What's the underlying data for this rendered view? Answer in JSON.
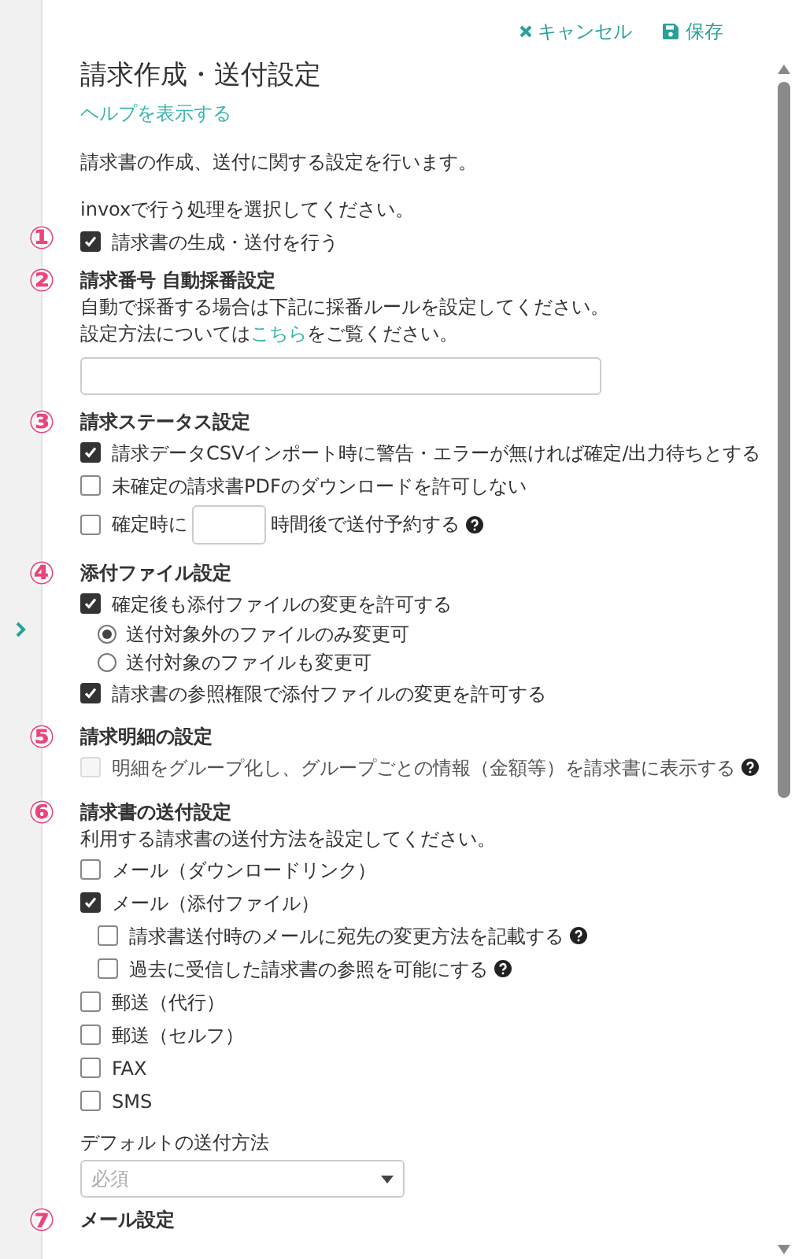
{
  "toolbar": {
    "cancel": "キャンセル",
    "save": "保存"
  },
  "title": "請求作成・送付設定",
  "help_link": "ヘルプを表示する",
  "description": "請求書の作成、送付に関する設定を行います。",
  "prompt": "invoxで行う処理を選択してください。",
  "sections": [
    {
      "marker": "①",
      "items": [
        {
          "kind": "checkbox",
          "label": "請求書の生成・送付を行う",
          "checked": true
        }
      ]
    },
    {
      "marker": "②",
      "heading": "請求番号 自動採番設定",
      "items": [
        {
          "kind": "text",
          "text": "自動で採番する場合は下記に採番ルールを設定してください。"
        },
        {
          "kind": "link_text",
          "before": "設定方法については",
          "link": "こちら",
          "after": "をご覧ください。"
        },
        {
          "kind": "field"
        }
      ]
    },
    {
      "marker": "③",
      "heading": "請求ステータス設定",
      "items": [
        {
          "kind": "checkbox",
          "label": "請求データCSVインポート時に警告・エラーが無ければ確定/出力待ちとする",
          "checked": true
        },
        {
          "kind": "checkbox",
          "label": "未確定の請求書PDFのダウンロードを許可しない",
          "checked": false
        },
        {
          "kind": "hours",
          "before": "確定時に",
          "after": "時間後で送付予約する",
          "checked": false,
          "help": true
        }
      ]
    },
    {
      "marker": "④",
      "heading": "添付ファイル設定",
      "items": [
        {
          "kind": "checkbox",
          "label": "確定後も添付ファイルの変更を許可する",
          "checked": true,
          "children": [
            {
              "kind": "radio",
              "label": "送付対象外のファイルのみ変更可",
              "selected": true
            },
            {
              "kind": "radio",
              "label": "送付対象のファイルも変更可",
              "selected": false
            }
          ]
        },
        {
          "kind": "checkbox",
          "label": "請求書の参照権限で添付ファイルの変更を許可する",
          "checked": true
        }
      ]
    },
    {
      "marker": "⑤",
      "heading": "請求明細の設定",
      "items": [
        {
          "kind": "checkbox",
          "label": "明細をグループ化し、グループごとの情報（金額等）を請求書に表示する",
          "checked": false,
          "disabled": true,
          "help": true
        }
      ]
    },
    {
      "marker": "⑥",
      "heading": "請求書の送付設定",
      "items": [
        {
          "kind": "text",
          "text": "利用する請求書の送付方法を設定してください。"
        },
        {
          "kind": "checkbox",
          "label": "メール（ダウンロードリンク）",
          "checked": false
        },
        {
          "kind": "checkbox",
          "label": "メール（添付ファイル）",
          "checked": true,
          "children": [
            {
              "kind": "checkbox",
              "label": "請求書送付時のメールに宛先の変更方法を記載する",
              "checked": false,
              "help": true
            },
            {
              "kind": "checkbox",
              "label": "過去に受信した請求書の参照を可能にする",
              "checked": false,
              "help": true
            }
          ]
        },
        {
          "kind": "checkbox",
          "label": "郵送（代行）",
          "checked": false
        },
        {
          "kind": "checkbox",
          "label": "郵送（セルフ）",
          "checked": false
        },
        {
          "kind": "checkbox",
          "label": "FAX",
          "checked": false
        },
        {
          "kind": "checkbox",
          "label": "SMS",
          "checked": false
        },
        {
          "kind": "select",
          "label": "デフォルトの送付方法",
          "placeholder": "必須"
        }
      ]
    },
    {
      "marker": "⑦",
      "heading": "メール設定"
    }
  ]
}
